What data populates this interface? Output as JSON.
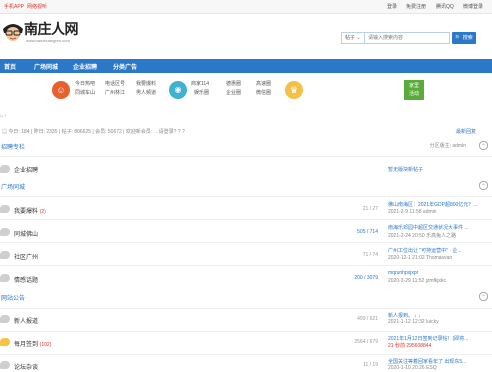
{
  "topbar": {
    "left": [
      "手机APP",
      "网络视听"
    ],
    "right": [
      "登录",
      "免费注册",
      "腾讯QQ",
      "微博登录"
    ]
  },
  "logo": {
    "name": "南庄人网",
    "url": "www.nanzhuangren.com"
  },
  "search": {
    "scope": "帖子 ⌄",
    "placeholder": "请输入搜索内容",
    "button": "🔍 搜索"
  },
  "nav": [
    "首页",
    "广场同城",
    "企业招聘",
    "分类广告"
  ],
  "quick": {
    "g1": [
      "今日热吧",
      "电话区号",
      "我要爆料",
      "同城车山",
      "广州林江",
      "男人频道"
    ],
    "g2": [
      "商家114",
      "娱乐圈",
      "德惠圈",
      "高速圈",
      "企业圈",
      "微信圈"
    ],
    "green": [
      "家里",
      "活动"
    ]
  },
  "crumb": "⌂ ›",
  "stats": {
    "left": "▤ 今日: 184 | 昨日: 2335 | 帖子: 806625 | 会员: 50672 | 欢迎新会员: →请登录? ? ?",
    "right": "最新回复"
  },
  "sections": [
    {
      "title": "招聘专栏",
      "meta": "分区版主: admin"
    },
    {
      "title": "广场同城",
      "meta": ""
    },
    {
      "title": "网站公告",
      "meta": ""
    }
  ],
  "rows": [
    {
      "name": "企业招聘",
      "count": "",
      "extra": "",
      "yellow": false,
      "l1": "暂无版块新帖子",
      "l2": ""
    },
    {
      "name": "我要爆料",
      "count": "(2)",
      "extra": "21 / 27",
      "yellow": false,
      "l1": "佛山南海区：2021年GDP超800亿元？...",
      "l2": "2021-2-9 11:58 admin"
    },
    {
      "name": "同城佛山",
      "count": "",
      "extra": "505 / 714",
      "yellow": false,
      "l1": "南海乐邓园中超区交通状况大事件 ...",
      "l2": "2021-2-24 20:50 乐高兔人之路"
    },
    {
      "name": "社区广州",
      "count": "",
      "extra": "71 / 74",
      "yellow": false,
      "l1": "广州工位出让 \"可持运营中\" · 企...",
      "l2": "2020-12-1 21:02 Thomasvan"
    },
    {
      "name": "情感话题",
      "count": "",
      "extra": "200 / 3079",
      "yellow": false,
      "l1": "mqrunhpxjxpr",
      "l2": "2020-3-29 11:52 jzmfkjxkc"
    },
    {
      "name": "新人报道",
      "count": "",
      "extra": "499 / 621",
      "yellow": false,
      "l1": "新人报到。 ↓ ↓",
      "l2": "2021-1-12 12:32 luicky"
    },
    {
      "name": "每月签到",
      "count": "(102)",
      "extra": "2564 / 679",
      "yellow": true,
      "l1": "2021年1月12日签到记录帖！(即将...",
      "l2": "21 秒前 295608844"
    },
    {
      "name": "论坛杂谈",
      "count": "",
      "extra": "11 / 19",
      "yellow": false,
      "l1": "全国关注等着回家看年了 出现东5...",
      "l2": "2020-1-10 20:26 ESQ"
    }
  ],
  "colors": {
    "accent": "#2b78c9",
    "brand_red": "#e0342a",
    "green": "#5aab3a",
    "orange": "#e8602c",
    "teal": "#3fb1d1",
    "yellow": "#f3c14a"
  }
}
